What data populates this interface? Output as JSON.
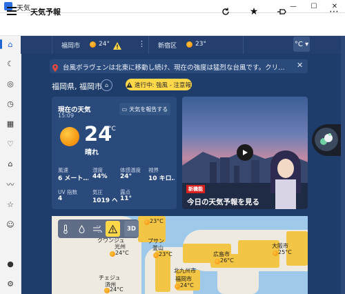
{
  "window": {
    "title": "天気",
    "minimize": "—",
    "maximize": "☐",
    "close": "✕"
  },
  "toolbar": {
    "app_name": "天気予報"
  },
  "locations": [
    {
      "name": "福岡市",
      "temp": "24°"
    },
    {
      "name": "新宿区",
      "temp": "23°"
    }
  ],
  "unit": "°C ▾",
  "alert": {
    "text": "台風ボラヴェンは北東に移動し続け、現在の強度は猛烈な台風です。クリ…"
  },
  "location_title": "福岡県, 福岡市",
  "warning_pill": "進行中: 強風 - 注意報",
  "current": {
    "title": "現在の天気",
    "time": "15:09",
    "report_button": "天気を報告する",
    "temp": "24",
    "unit": "°C",
    "condition": "晴れ",
    "metrics": [
      {
        "label": "風速",
        "value": "6 メート…"
      },
      {
        "label": "湿度",
        "value": "44%"
      },
      {
        "label": "体感温度",
        "value": "24°"
      },
      {
        "label": "視界",
        "value": "10 キロ…"
      },
      {
        "label": "UV 指数",
        "value": "4"
      },
      {
        "label": "気圧",
        "value": "1019 へ…"
      },
      {
        "label": "露点",
        "value": "11°"
      }
    ]
  },
  "video": {
    "badge": "新機能",
    "caption": "今日の天気予報を見る"
  },
  "map": {
    "tool_3d": "3D",
    "cities": [
      {
        "name": "",
        "temp": "23°C"
      },
      {
        "name": "クワンジュ",
        "temp": ""
      },
      {
        "name": "光州",
        "temp": "24°C"
      },
      {
        "name": "プサン",
        "temp": ""
      },
      {
        "name": "釜山",
        "temp": "23°C"
      },
      {
        "name": "広島市",
        "temp": "26°C"
      },
      {
        "name": "大阪市",
        "temp": "25°C"
      },
      {
        "name": "北九州市",
        "temp": ""
      },
      {
        "name": "福岡市",
        "temp": "24°C"
      },
      {
        "name": "チェジュ",
        "temp": ""
      },
      {
        "name": "済州",
        "temp": "24°C"
      }
    ]
  }
}
